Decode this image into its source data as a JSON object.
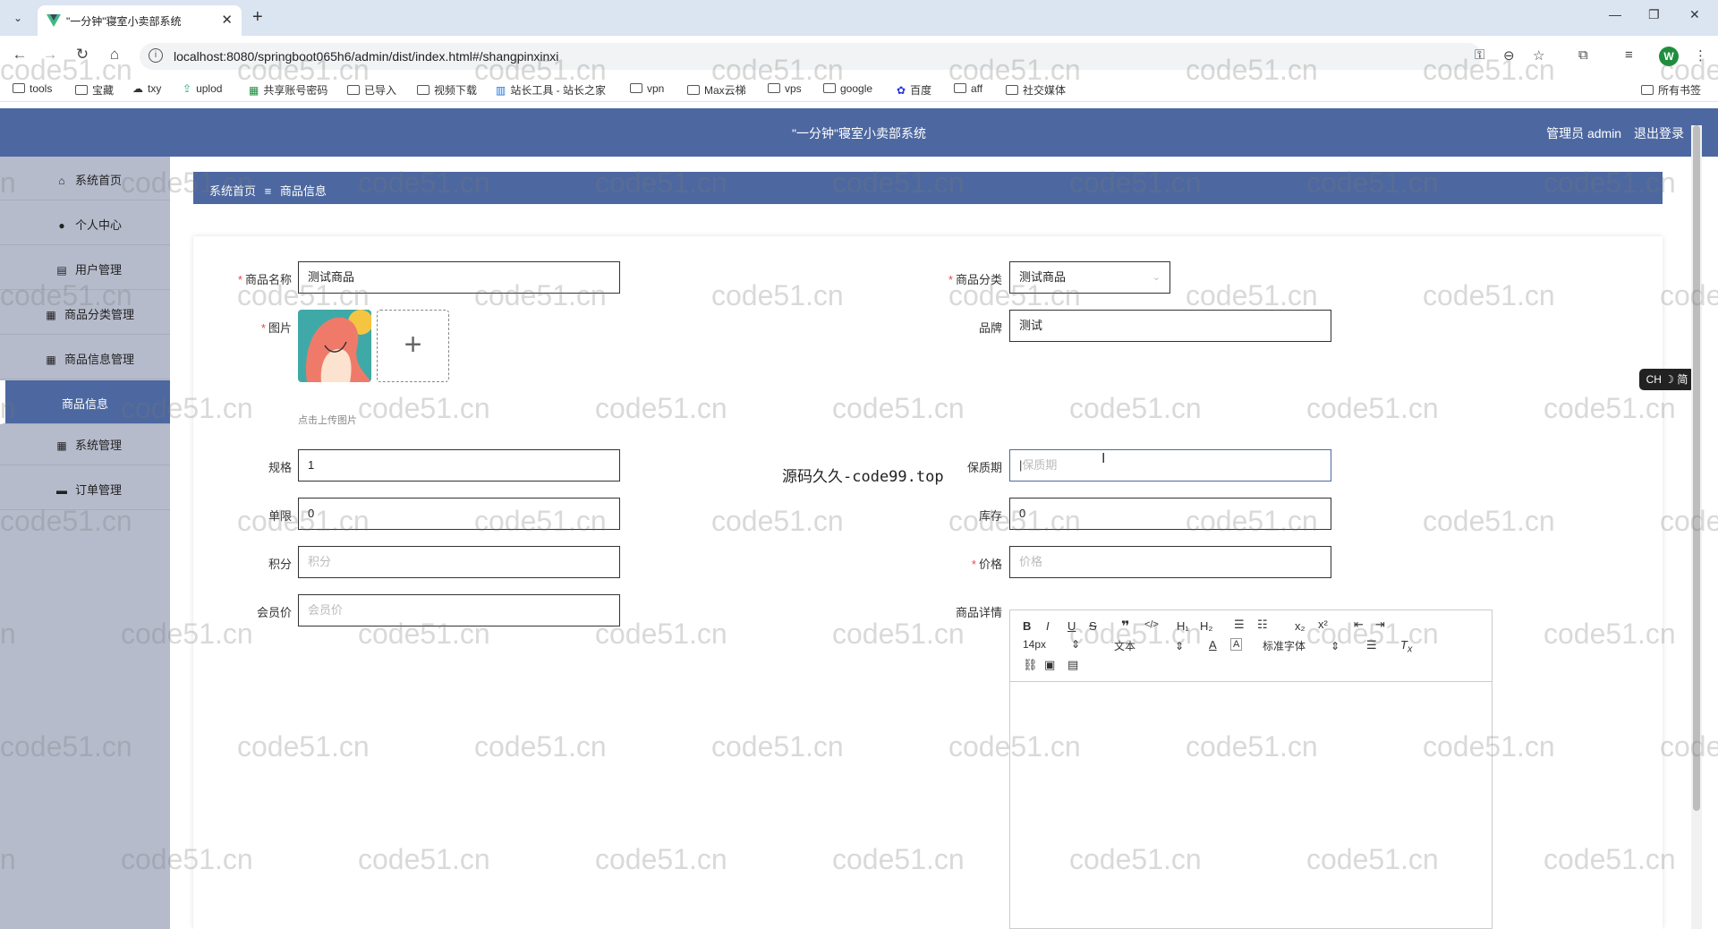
{
  "browser": {
    "tab_title": "\"一分钟\"寝室小卖部系统",
    "url": "localhost:8080/springboot065h6/admin/dist/index.html#/shangpinxinxi",
    "avatar_letter": "W",
    "bookmarks": [
      "tools",
      "宝藏",
      "txy",
      "uplod",
      "共享账号密码",
      "已导入",
      "视频下载",
      "站长工具 - 站长之家",
      "vpn",
      "Max云梯",
      "vps",
      "google",
      "百度",
      "aff",
      "社交媒体"
    ],
    "all_bookmarks": "所有书签"
  },
  "app": {
    "title": "\"一分钟\"寝室小卖部系统",
    "user_label": "管理员 admin",
    "logout": "退出登录"
  },
  "sidebar": {
    "items": [
      {
        "label": "系统首页",
        "icon": "home-icon"
      },
      {
        "label": "个人中心",
        "icon": "person-icon"
      },
      {
        "label": "用户管理",
        "icon": "clipboard-icon"
      },
      {
        "label": "商品分类管理",
        "icon": "grid-icon"
      },
      {
        "label": "商品信息管理",
        "icon": "grid-icon"
      },
      {
        "label": "商品信息",
        "icon": ""
      },
      {
        "label": "系统管理",
        "icon": "grid-icon"
      },
      {
        "label": "订单管理",
        "icon": "cart-icon"
      }
    ]
  },
  "breadcrumb": {
    "home": "系统首页",
    "separator": "≡",
    "current": "商品信息"
  },
  "form": {
    "name_label": "商品名称",
    "name_value": "测试商品",
    "category_label": "商品分类",
    "category_value": "测试商品",
    "image_label": "图片",
    "upload_hint": "点击上传图片",
    "brand_label": "品牌",
    "brand_value": "测试",
    "spec_label": "规格",
    "spec_value": "1",
    "shelf_label": "保质期",
    "shelf_placeholder": "保质期",
    "limit_label": "单限",
    "limit_value": "0",
    "stock_label": "库存",
    "stock_value": "0",
    "points_label": "积分",
    "points_placeholder": "积分",
    "price_label": "价格",
    "price_placeholder": "价格",
    "member_label": "会员价",
    "member_placeholder": "会员价",
    "detail_label": "商品详情"
  },
  "editor": {
    "font_size": "14px",
    "paragraph": "文本",
    "font_family": "标准字体"
  },
  "overlay": {
    "code_text": "源码久久-code99.top",
    "watermark": "code51.cn",
    "ime_badge": "CH ☽ 简"
  },
  "colors": {
    "header_bg": "#4d68a0",
    "sidebar_bg": "#b6bbcc",
    "required": "#e44444"
  }
}
